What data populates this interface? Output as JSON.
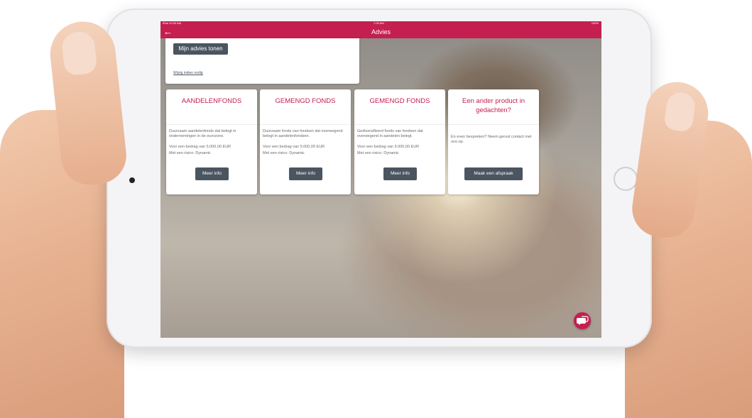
{
  "status_bar": {
    "left": "iPad 10:30 AM",
    "center": "7:09 AM",
    "right": "100%"
  },
  "nav": {
    "back_icon": "arrow-left-icon",
    "title": "Advies"
  },
  "top_card": {
    "button_label": "Mijn advies tonen",
    "link_label": "Wijzig indien nodig"
  },
  "cards": [
    {
      "title": "AANDELENFONDS",
      "description": "Duurzaam aandelenfonds dat belegt in ondernemingen in de eurozone.",
      "amount": "Voor een bedrag van 5.000,00 EUR",
      "risk": "Met een risico: Dynamic",
      "button": "Meer info"
    },
    {
      "title": "GEMENGD FONDS",
      "description": "Duurzaam fonds van fondsen dat overwegend belegt in aandelenfondsen.",
      "amount": "Voor een bedrag van 5.000,00 EUR",
      "risk": "Met een risico: Dynamic",
      "button": "Meer info"
    },
    {
      "title": "GEMENGD FONDS",
      "description": "Gediversifieerd fonds van fondsen dat overwegend in aandelen belegt.",
      "amount": "Voor een bedrag van 5.000,00 EUR",
      "risk": "Met een risico: Dynamic",
      "button": "Meer info"
    },
    {
      "title": "Een ander product in gedachten?",
      "description": "En even bespreken? Neem gerust contact met ons op.",
      "button": "Maak een afspraak"
    }
  ],
  "chat_icon": "chat-bubble-icon",
  "colors": {
    "brand": "#c41f4f",
    "button": "#4a5560"
  }
}
